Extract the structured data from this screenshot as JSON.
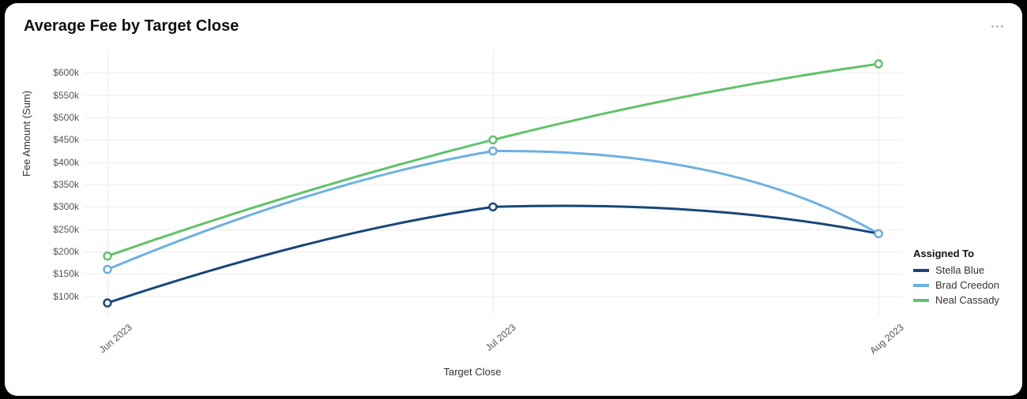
{
  "title": "Average Fee by Target Close",
  "xlabel": "Target Close",
  "ylabel": "Fee Amount (Sum)",
  "legend_title": "Assigned To",
  "y_ticks": [
    "$100k",
    "$150k",
    "$200k",
    "$250k",
    "$300k",
    "$350k",
    "$400k",
    "$450k",
    "$500k",
    "$550k",
    "$600k"
  ],
  "x_ticks": [
    "Jun 2023",
    "Jul 2023",
    "Aug 2023"
  ],
  "series": [
    {
      "name": "Stella Blue",
      "color": "#17467a"
    },
    {
      "name": "Brad Creedon",
      "color": "#6db0e3"
    },
    {
      "name": "Neal Cassady",
      "color": "#60c26a"
    }
  ],
  "chart_data": {
    "type": "line",
    "title": "Average Fee by Target Close",
    "xlabel": "Target Close",
    "ylabel": "Fee Amount (Sum)",
    "categories": [
      "Jun 2023",
      "Jul 2023",
      "Aug 2023"
    ],
    "ylim": [
      50000,
      650000
    ],
    "y_ticks": [
      100000,
      150000,
      200000,
      250000,
      300000,
      350000,
      400000,
      450000,
      500000,
      550000,
      600000
    ],
    "series": [
      {
        "name": "Stella Blue",
        "color": "#17467a",
        "values": [
          85000,
          300000,
          240000
        ]
      },
      {
        "name": "Brad Creedon",
        "color": "#6db0e3",
        "values": [
          160000,
          425000,
          240000
        ]
      },
      {
        "name": "Neal Cassady",
        "color": "#60c26a",
        "values": [
          190000,
          450000,
          620000
        ]
      }
    ],
    "legend": {
      "title": "Assigned To",
      "position": "right"
    }
  }
}
